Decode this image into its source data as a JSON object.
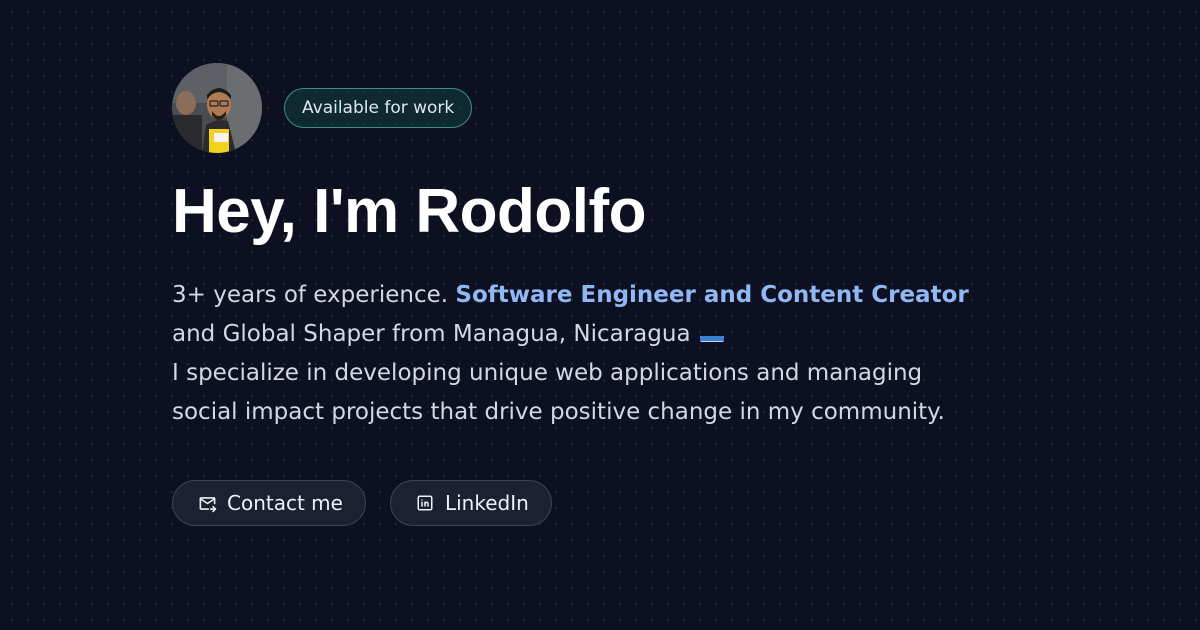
{
  "profile": {
    "avatar_alt": "Rodolfo profile photo",
    "availability": "Available for work"
  },
  "hero": {
    "title": "Hey, I'm Rodolfo",
    "bio_part1": "3+ years of experience. ",
    "bio_accent": "Software Engineer and Content Creator",
    "bio_part2": " and Global Shaper from Managua, Nicaragua ",
    "bio_flag_icon": "nicaragua-flag-icon",
    "bio_line2": "I specialize in developing unique web applications and managing social impact projects that drive positive change in my community."
  },
  "actions": {
    "contact_label": "Contact me",
    "contact_icon": "mail-icon",
    "linkedin_label": "LinkedIn",
    "linkedin_icon": "linkedin-icon"
  },
  "colors": {
    "background": "#0c1021",
    "accent": "#8fb8f5",
    "badge_border": "#3f8f84"
  }
}
